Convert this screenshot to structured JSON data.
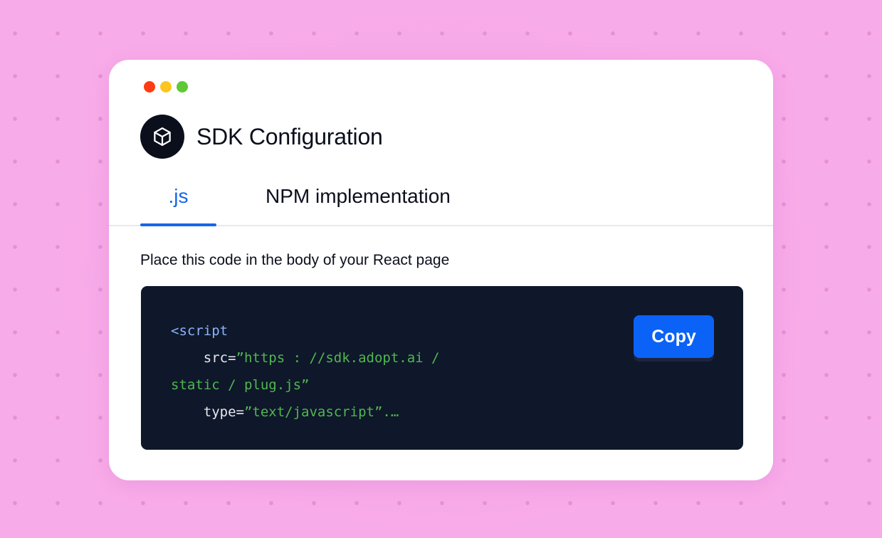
{
  "window": {
    "title": "SDK Configuration",
    "icon": "cube-icon"
  },
  "tabs": [
    {
      "label": ".js",
      "active": true
    },
    {
      "label": "NPM implementation",
      "active": false
    }
  ],
  "instructions": "Place this code in the body of your React page",
  "code": {
    "line1": "<script",
    "line2_attr": "    src=",
    "line2_value": "”https : //sdk.adopt.ai /",
    "line3_value": "static / plug.js”",
    "line4_attr": "    type=",
    "line4_value": "”text/javascript”.…"
  },
  "copy_label": "Copy",
  "colors": {
    "accent": "#1766e8",
    "button": "#0b62f6",
    "code_bg": "#0f172a",
    "code_string": "#4fb84f",
    "code_tag": "#8ab4f8",
    "background": "#f8abe9",
    "traffic_red": "#fe3b12",
    "traffic_yellow": "#fdc61f",
    "traffic_green": "#5ec935"
  }
}
